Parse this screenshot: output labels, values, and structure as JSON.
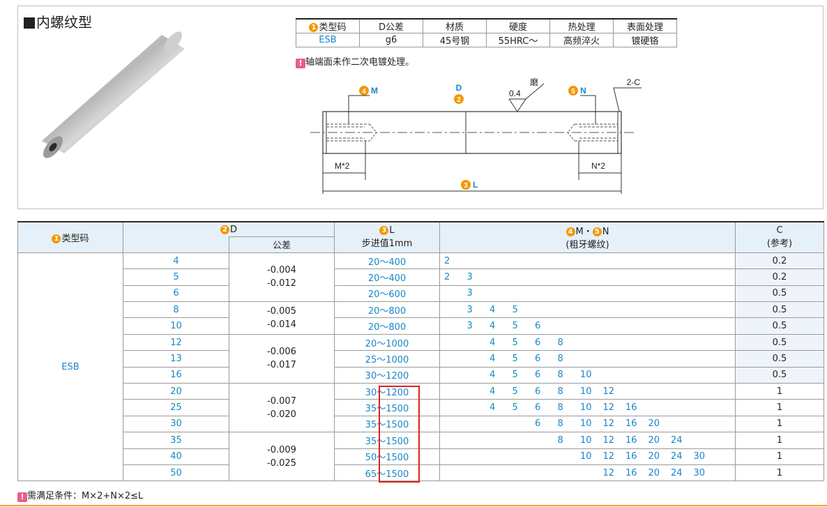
{
  "title": "内螺纹型",
  "spec_table": {
    "headers": [
      "类型码",
      "D公差",
      "材质",
      "硬度",
      "热处理",
      "表面处理"
    ],
    "values": [
      "ESB",
      "g6",
      "45号钢",
      "55HRC～",
      "高频淬火",
      "镀硬铬"
    ],
    "header_nums": [
      "1"
    ]
  },
  "note1": "轴端面未作二次电镀处理。",
  "drawing": {
    "label_m": "M",
    "label_n": "N",
    "label_d": "D",
    "label_l": "L",
    "roughness": "0.4",
    "grind": "磨",
    "chamfer": "2-C",
    "m2": "M*2",
    "n2": "N*2",
    "n1": "1",
    "n2num": "2",
    "n3": "3",
    "n4": "4",
    "n5": "5"
  },
  "main_table": {
    "h_type": "类型码",
    "h_d": "D",
    "h_tol": "公差",
    "h_l": "L",
    "h_step": "步进值1mm",
    "h_mn": "M・",
    "h_mn_n": "N",
    "h_thread": "(粗牙螺纹)",
    "h_c": "C",
    "h_ref": "(参考)",
    "type": "ESB",
    "tol_groups": [
      {
        "upper": "-0.004",
        "lower": "-0.012"
      },
      {
        "upper": "-0.005",
        "lower": "-0.014"
      },
      {
        "upper": "-0.006",
        "lower": "-0.017"
      },
      {
        "upper": "-0.007",
        "lower": "-0.020"
      },
      {
        "upper": "-0.009",
        "lower": "-0.025"
      }
    ],
    "rows": [
      {
        "d": "4",
        "l": "20～400",
        "mn": [
          "2",
          "",
          "",
          "",
          "",
          "",
          "",
          "",
          "",
          "",
          ""
        ],
        "c": "0.2"
      },
      {
        "d": "5",
        "l": "20～400",
        "mn": [
          "2",
          "3",
          "",
          "",
          "",
          "",
          "",
          "",
          "",
          "",
          ""
        ],
        "c": "0.2"
      },
      {
        "d": "6",
        "l": "20～600",
        "mn": [
          "",
          "3",
          "",
          "",
          "",
          "",
          "",
          "",
          "",
          "",
          ""
        ],
        "c": "0.5"
      },
      {
        "d": "8",
        "l": "20～800",
        "mn": [
          "",
          "3",
          "4",
          "5",
          "",
          "",
          "",
          "",
          "",
          "",
          ""
        ],
        "c": "0.5"
      },
      {
        "d": "10",
        "l": "20～800",
        "mn": [
          "",
          "3",
          "4",
          "5",
          "6",
          "",
          "",
          "",
          "",
          "",
          ""
        ],
        "c": "0.5"
      },
      {
        "d": "12",
        "l": "20～1000",
        "mn": [
          "",
          "",
          "4",
          "5",
          "6",
          "8",
          "",
          "",
          "",
          "",
          ""
        ],
        "c": "0.5"
      },
      {
        "d": "13",
        "l": "25～1000",
        "mn": [
          "",
          "",
          "4",
          "5",
          "6",
          "8",
          "",
          "",
          "",
          "",
          ""
        ],
        "c": "0.5"
      },
      {
        "d": "16",
        "l": "30～1200",
        "mn": [
          "",
          "",
          "4",
          "5",
          "6",
          "8",
          "10",
          "",
          "",
          "",
          ""
        ],
        "c": "0.5"
      },
      {
        "d": "20",
        "l": "30～1200",
        "mn": [
          "",
          "",
          "4",
          "5",
          "6",
          "8",
          "10",
          "12",
          "",
          "",
          ""
        ],
        "c": "1"
      },
      {
        "d": "25",
        "l": "35～1500",
        "mn": [
          "",
          "",
          "4",
          "5",
          "6",
          "8",
          "10",
          "12",
          "16",
          "",
          ""
        ],
        "c": "1"
      },
      {
        "d": "30",
        "l": "35～1500",
        "mn": [
          "",
          "",
          "",
          "",
          "6",
          "8",
          "10",
          "12",
          "16",
          "20",
          ""
        ],
        "c": "1"
      },
      {
        "d": "35",
        "l": "35～1500",
        "mn": [
          "",
          "",
          "",
          "",
          "",
          "8",
          "10",
          "12",
          "16",
          "20",
          "24"
        ],
        "c": "1"
      },
      {
        "d": "40",
        "l": "50～1500",
        "mn": [
          "",
          "",
          "",
          "",
          "",
          "",
          "10",
          "12",
          "16",
          "20",
          "24",
          "30"
        ],
        "c": "1"
      },
      {
        "d": "50",
        "l": "65～1500",
        "mn": [
          "",
          "",
          "",
          "",
          "",
          "",
          "",
          "12",
          "16",
          "20",
          "24",
          "30"
        ],
        "c": "1"
      }
    ]
  },
  "note2": "需满足条件：M×2+N×2≤L",
  "colors": {
    "accent_blue": "#1a86c8",
    "orange": "#f39800",
    "warn_pink": "#e8608a",
    "highlight_red": "#e02020"
  }
}
